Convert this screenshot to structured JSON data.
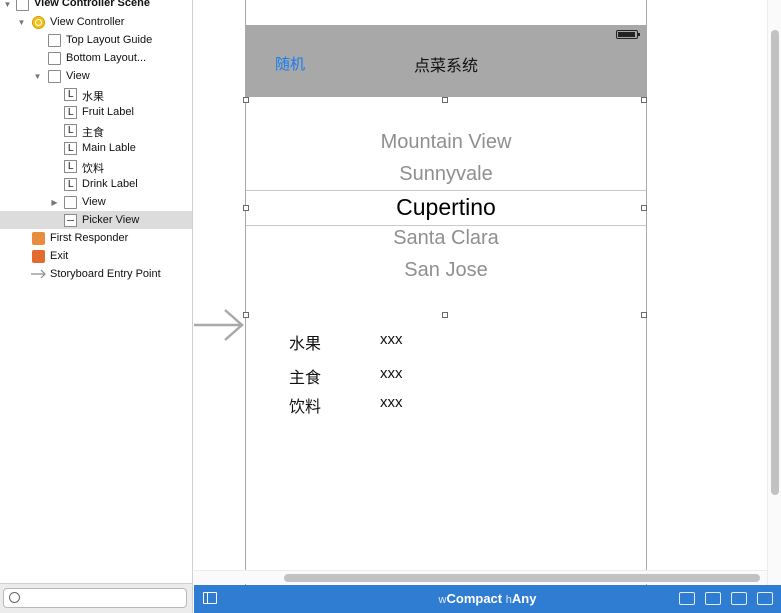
{
  "outline": {
    "scene_title": "View Controller Scene",
    "view_controller": "View Controller",
    "top_guide": "Top Layout Guide",
    "bottom_guide": "Bottom Layout...",
    "view": "View",
    "label_fruit_cn": "水果",
    "fruit_label": "Fruit Label",
    "label_main_cn": "主食",
    "main_lable": "Main Lable",
    "label_drink_cn": "饮料",
    "drink_label": "Drink Label",
    "subview": "View",
    "picker_view": "Picker View",
    "first_responder": "First Responder",
    "exit": "Exit",
    "entry_point": "Storyboard Entry Point",
    "label_icon_glyph": "L"
  },
  "nav": {
    "left_button": "随机",
    "title": "点菜系统"
  },
  "picker": {
    "rows": [
      "Mountain View",
      "Sunnyvale",
      "Cupertino",
      "Santa Clara",
      "San Jose"
    ],
    "selected_index": 2
  },
  "fields": [
    {
      "label": "水果",
      "value": "xxx"
    },
    {
      "label": "主食",
      "value": "xxx"
    },
    {
      "label": "饮料",
      "value": "xxx"
    }
  ],
  "size_class": {
    "w_prefix": "w",
    "w_value": "Compact",
    "h_prefix": "h",
    "h_value": "Any"
  },
  "colors": {
    "accent": "#1a7cf0",
    "nav_bar": "#a8a8a8",
    "bottom_bar": "#2f7cd3",
    "selection": "#dcdcdc"
  }
}
